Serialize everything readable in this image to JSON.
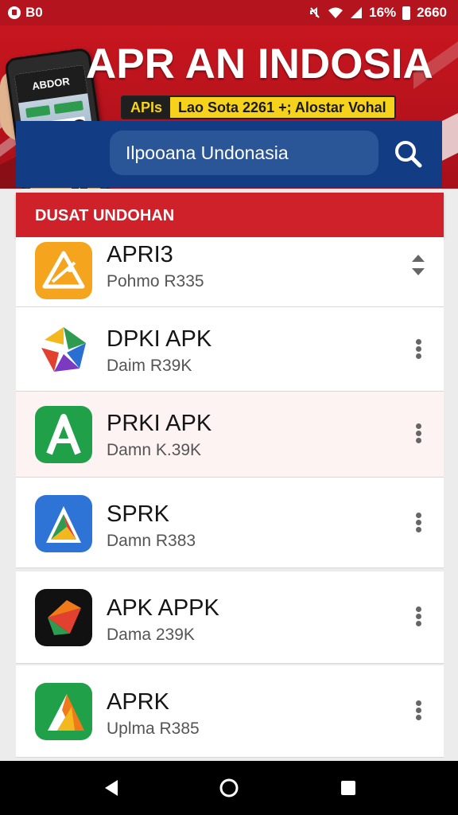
{
  "status_bar": {
    "left_text": "B0",
    "battery": "16%",
    "time": "2660"
  },
  "banner": {
    "title": "APR AN INDOSIA",
    "phone_screen_text": "ABDOR",
    "promo_tag": "APIs",
    "promo_text": "Lao Sota 2261 +; Alostar Vohal"
  },
  "search": {
    "value": "Ilpooana Undonasia"
  },
  "list": {
    "header": "DUSAT UNDOHAN",
    "items": [
      {
        "name": "APRI3",
        "sub": "Pohmo R335",
        "icon": "warning-sign-icon",
        "more": "sort-arrows-icon"
      },
      {
        "name": "DPKI APK",
        "sub": "Daim R39K",
        "icon": "colorful-arrow-icon",
        "more": "more-vert-icon"
      },
      {
        "name": "PRKI APK",
        "sub": "Damn K.39K",
        "icon": "green-a-icon",
        "more": "more-vert-icon"
      },
      {
        "name": "SPRK",
        "sub": "Damn R383",
        "icon": "blue-a-icon",
        "more": "more-vert-icon"
      },
      {
        "name": "APK APPK",
        "sub": "Dama 239K",
        "icon": "black-arrow-icon",
        "more": "more-vert-icon"
      },
      {
        "name": "APRK",
        "sub": "Uplma R385",
        "icon": "green-orange-a-icon",
        "more": "more-vert-icon"
      }
    ]
  },
  "colors": {
    "brand_red": "#c8161f",
    "search_blue": "#123d84",
    "list_header": "#cf2129"
  },
  "nav": {
    "back": "back-icon",
    "home": "home-icon",
    "recents": "recents-icon"
  }
}
